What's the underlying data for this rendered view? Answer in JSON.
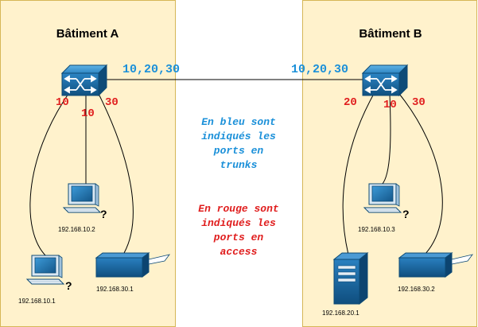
{
  "colors": {
    "building_fill": "#fff2cc",
    "building_border": "#d6b656",
    "trunk": "#1b90d9",
    "access": "#e01e1e"
  },
  "building_a": {
    "title": "Bâtiment A",
    "trunk_ports": "10,20,30",
    "access_ports": {
      "left": "10",
      "center": "10",
      "right": "30"
    },
    "hosts": [
      {
        "ip": "192.168.10.2",
        "icon": "workstation-icon"
      },
      {
        "ip": "192.168.10.1",
        "icon": "workstation-icon"
      },
      {
        "ip": "192.168.30.1",
        "icon": "printer-icon"
      }
    ]
  },
  "building_b": {
    "title": "Bâtiment B",
    "trunk_ports": "10,20,30",
    "access_ports": {
      "left": "20",
      "center": "10",
      "right": "30"
    },
    "hosts": [
      {
        "ip": "192.168.10.3",
        "icon": "workstation-icon"
      },
      {
        "ip": "192.168.20.1",
        "icon": "server-icon"
      },
      {
        "ip": "192.168.30.2",
        "icon": "printer-icon"
      }
    ]
  },
  "legend": {
    "trunk_lines": [
      "En bleu sont",
      "indiqués les",
      "ports en",
      "trunks"
    ],
    "access_lines": [
      "En rouge sont",
      "indiqués les",
      "ports en",
      "access"
    ]
  },
  "question_mark": "?"
}
